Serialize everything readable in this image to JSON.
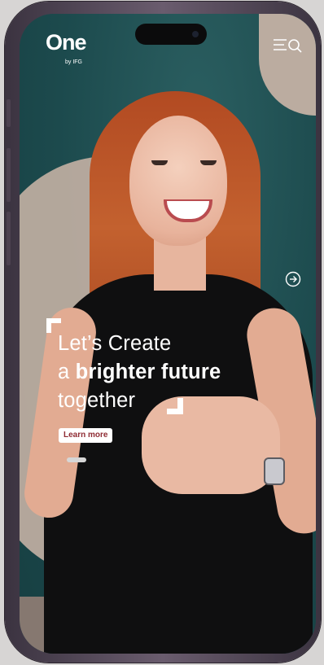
{
  "brand": {
    "logo_text": "One",
    "byline": "by IFG"
  },
  "hero": {
    "line1": "Let’s Create",
    "line2_prefix": "a ",
    "line2_bold": "brighter future",
    "line3": "together",
    "cta_label": "Learn more"
  },
  "icons": {
    "menu": "menu-search-icon",
    "next": "arrow-right-circle-icon"
  },
  "colors": {
    "background_teal": "#1e4a4d",
    "accent_beige": "#c4b1a4",
    "cta_text": "#8f2c34"
  }
}
